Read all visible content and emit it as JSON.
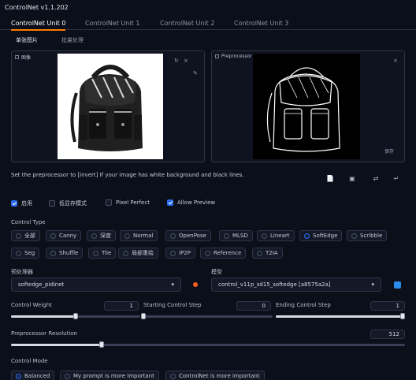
{
  "app": {
    "title": "ControlNet v1.1.202"
  },
  "tabs": [
    "ControlNet Unit 0",
    "ControlNet Unit 1",
    "ControlNet Unit 2",
    "ControlNet Unit 3"
  ],
  "subtabs": [
    "单张图片",
    "批量处理"
  ],
  "image_panel": {
    "label": "图像",
    "tools": [
      "↻",
      "×",
      "✎"
    ]
  },
  "preview_panel": {
    "label": "Preprocessor Preview",
    "close": "×",
    "save": "保存"
  },
  "hint": "Set the preprocessor to [invert] If your image has white background and black lines.",
  "action_icons": [
    "📄",
    "▣",
    "⇄",
    "↵"
  ],
  "options": {
    "enable": {
      "label": "启用",
      "checked": true
    },
    "lowvram": {
      "label": "低显存模式",
      "checked": false
    },
    "pixel_perfect": {
      "label": "Pixel Perfect",
      "checked": false
    },
    "allow_preview": {
      "label": "Allow Preview",
      "checked": true
    }
  },
  "control_type": {
    "label": "Control Type",
    "items": [
      "全部",
      "Canny",
      "深度",
      "Normal",
      "OpenPose",
      "MLSD",
      "Lineart",
      "SoftEdge",
      "Scribble",
      "Seg",
      "Shuffle",
      "Tile",
      "局部重绘",
      "IP2P",
      "Reference",
      "T2IA"
    ],
    "selected": "SoftEdge"
  },
  "preprocessor": {
    "label": "预处理器",
    "value": "softedge_pidinet"
  },
  "model": {
    "label": "模型",
    "value": "control_v11p_sd15_softedge [a8575a2a]"
  },
  "control_weight": {
    "label": "Control Weight",
    "value": "1",
    "fraction": 0.5
  },
  "starting_step": {
    "label": "Starting Control Step",
    "value": "0",
    "fraction": 0.0
  },
  "ending_step": {
    "label": "Ending Control Step",
    "value": "1",
    "fraction": 1.0
  },
  "resolution": {
    "label": "Preprocessor Resolution",
    "value": "512",
    "fraction": 0.23
  },
  "control_mode": {
    "label": "Control Mode",
    "items": [
      "Balanced",
      "My prompt is more important",
      "ControlNet is more important"
    ],
    "selected": "Balanced"
  },
  "colors": {
    "accent": "#2b6cf0",
    "tab_underline": "#ff7c00",
    "background": "#0b0f19"
  }
}
